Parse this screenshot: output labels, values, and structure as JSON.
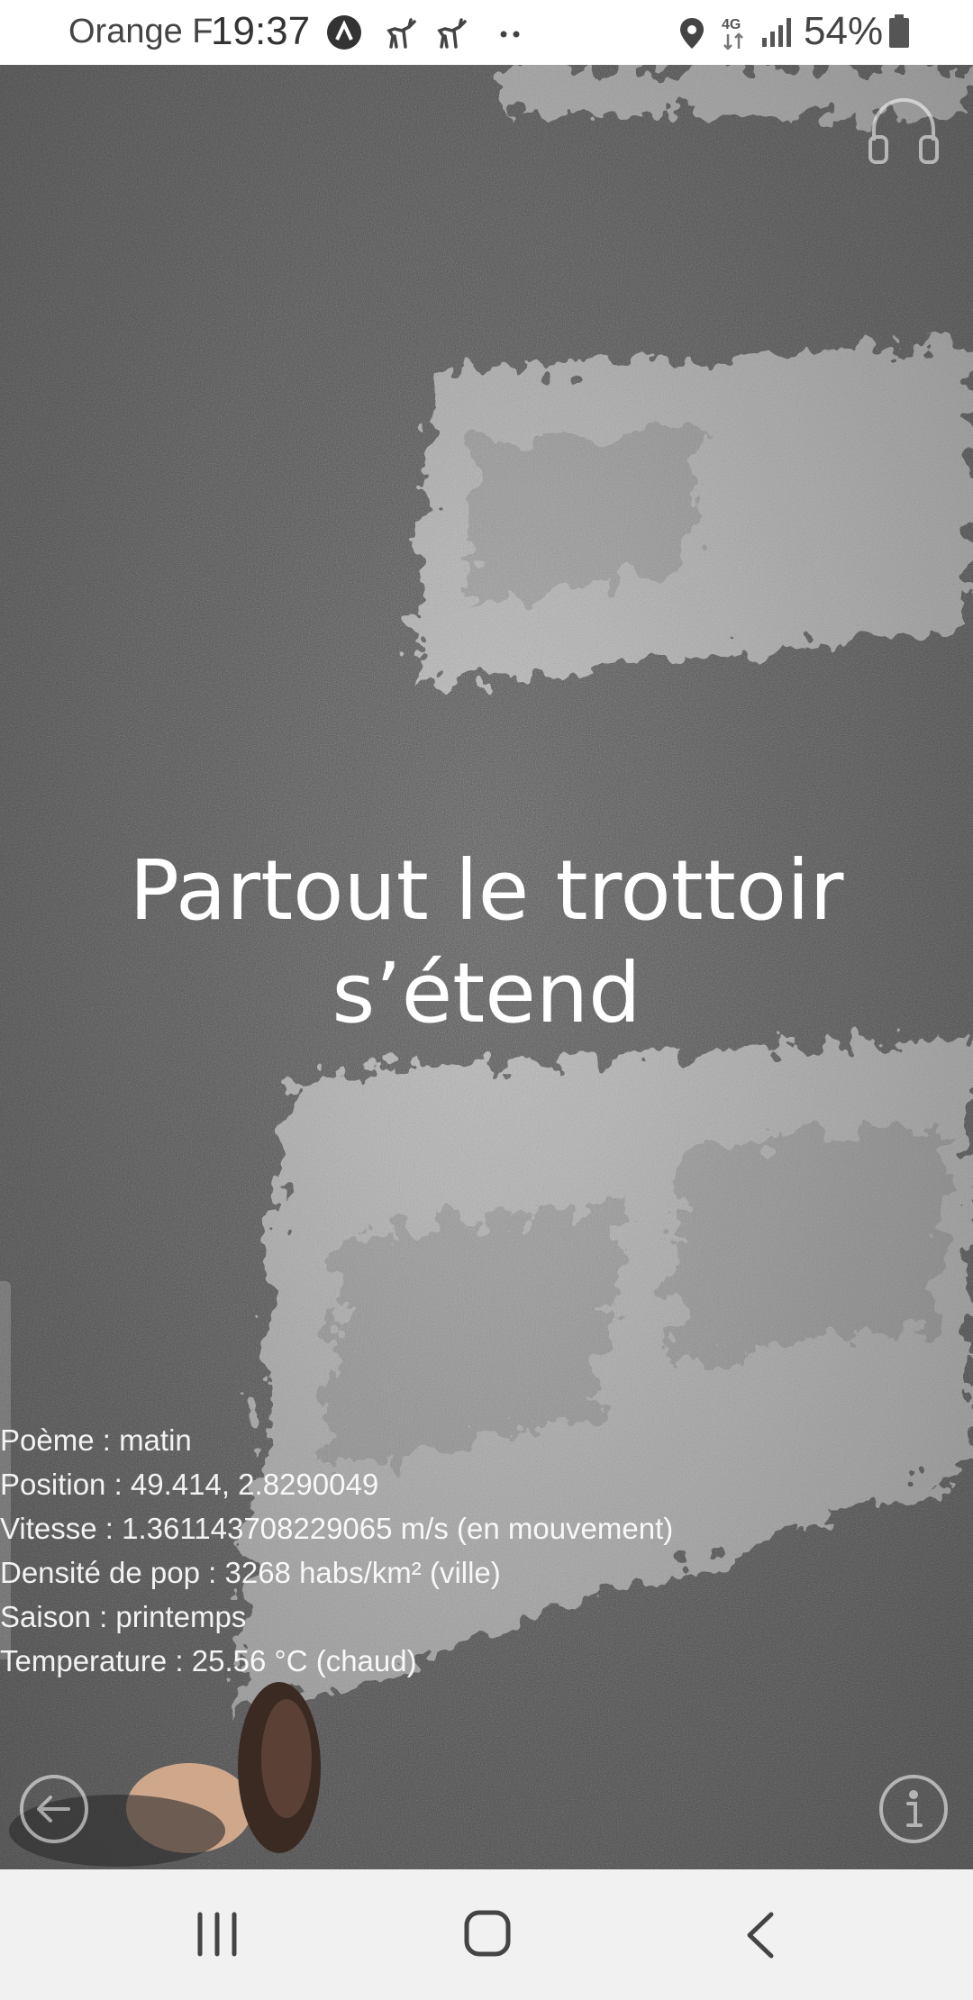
{
  "status_bar": {
    "carrier": "Orange F",
    "time": "19:37",
    "battery": "54%",
    "network": "4G",
    "icons": [
      "app-a-icon",
      "deer-icon",
      "deer-icon",
      "more-dots-icon",
      "location-icon",
      "network-4g-icon",
      "signal-icon",
      "battery-icon"
    ]
  },
  "poem": {
    "line1": "Partout le trottoir",
    "line2": "s’étend"
  },
  "info": {
    "poem": "Poème : matin",
    "position": "Position : 49.414, 2.8290049",
    "speed": "Vitesse : 1.361143708229065 m/s (en mouvement)",
    "density": "Densité de pop : 3268 habs/km² (ville)",
    "season": "Saison : printemps",
    "temperature": "Temperature : 25.56 °C (chaud)"
  },
  "overlay_buttons": [
    "headphones-icon",
    "arrow-left-icon",
    "info-icon"
  ],
  "nav_bar": {
    "icons": [
      "recents-icon",
      "home-icon",
      "back-chevron-icon"
    ]
  },
  "colors": {
    "asphalt": "#5b5b5b",
    "paint": "#d9d9d9",
    "status_bar_bg": "#ffffff",
    "nav_bar_bg": "#f1f1f1",
    "overlay_text": "#ffffff"
  }
}
